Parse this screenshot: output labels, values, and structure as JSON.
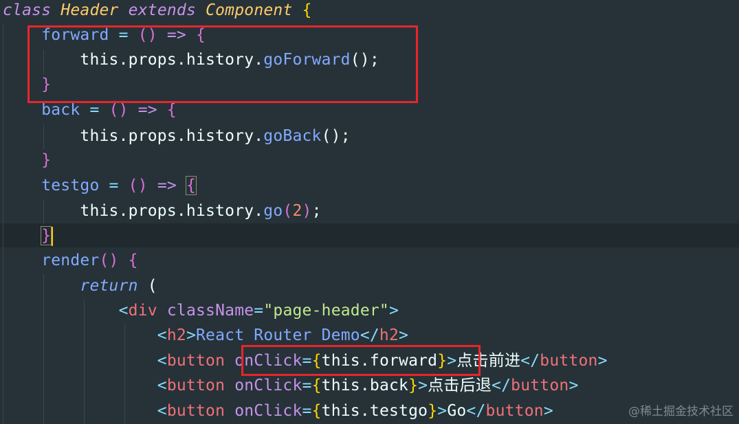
{
  "code": {
    "kw_class": "class",
    "class_name": "Header",
    "kw_extends": "extends",
    "parent_class": "Component",
    "open_brace": "{",
    "forward_name": "forward",
    "back_name": "back",
    "testgo_name": "testgo",
    "assign": " = ",
    "parens": "()",
    "arrow": " => ",
    "close_brace": "}",
    "this_props_history": "this.props.history.",
    "go_forward_call": "goForward",
    "go_back_call": "goBack",
    "go_call": "go",
    "call_parens": "();",
    "go_arg": "2",
    "render_name": "render",
    "kw_return": "return",
    "open_paren": "(",
    "div_tag": "div",
    "classname_attr": "className",
    "page_header_str": "\"page-header\"",
    "h2_tag": "h2",
    "h2_text": "React Router Demo",
    "button_tag": "button",
    "onclick_attr": "onClick",
    "this_forward": "this.forward",
    "this_back": "this.back",
    "this_testgo": "this.testgo",
    "forward_label": "点击前进",
    "back_label": "点击后退",
    "go_label": "Go"
  },
  "watermark": "@稀土掘金技术社区",
  "colors": {
    "background": "#263238",
    "highlight_box": "#e8262b"
  }
}
